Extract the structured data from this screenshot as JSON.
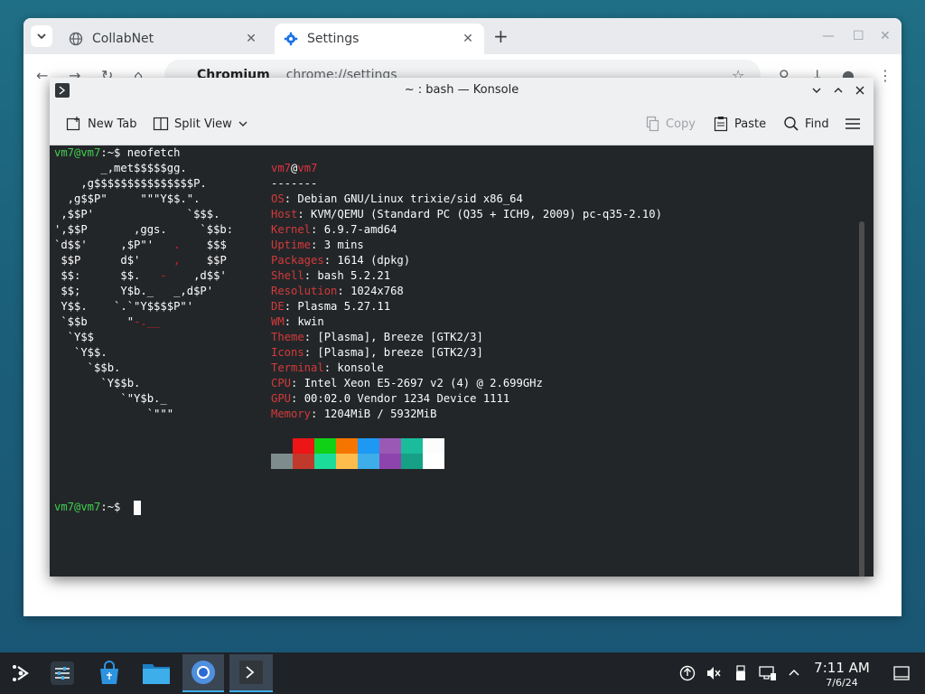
{
  "colors": {
    "terminal_bg": "#232629",
    "prompt_green": "#3fd04f",
    "key_red": "#d33a3a",
    "accent_blue": "#3daee9"
  },
  "browser": {
    "tabs": [
      {
        "title": "CollabNet",
        "icon": "globe-icon"
      },
      {
        "title": "Settings",
        "icon": "gear-icon"
      }
    ],
    "omnibox_chip": "Chromium",
    "url": "chrome://settings"
  },
  "konsole": {
    "title": "~ : bash — Konsole",
    "toolbar": {
      "new_tab": "New Tab",
      "split_view": "Split View",
      "copy": "Copy",
      "paste": "Paste",
      "find": "Find"
    },
    "terminal": {
      "prompt_user": "vm7@vm7",
      "prompt_suffix": ":~$",
      "command": "neofetch",
      "header_user": "vm7",
      "header_at": "@",
      "header_host": "vm7",
      "separator": "-------",
      "info": [
        {
          "key": "OS",
          "value": "Debian GNU/Linux trixie/sid x86_64"
        },
        {
          "key": "Host",
          "value": "KVM/QEMU (Standard PC (Q35 + ICH9, 2009) pc-q35-2.10)"
        },
        {
          "key": "Kernel",
          "value": "6.9.7-amd64"
        },
        {
          "key": "Uptime",
          "value": "3 mins"
        },
        {
          "key": "Packages",
          "value": "1614 (dpkg)"
        },
        {
          "key": "Shell",
          "value": "bash 5.2.21"
        },
        {
          "key": "Resolution",
          "value": "1024x768"
        },
        {
          "key": "DE",
          "value": "Plasma 5.27.11"
        },
        {
          "key": "WM",
          "value": "kwin"
        },
        {
          "key": "Theme",
          "value": "[Plasma], Breeze [GTK2/3]"
        },
        {
          "key": "Icons",
          "value": "[Plasma], breeze [GTK2/3]"
        },
        {
          "key": "Terminal",
          "value": "konsole"
        },
        {
          "key": "CPU",
          "value": "Intel Xeon E5-2697 v2 (4) @ 2.699GHz"
        },
        {
          "key": "GPU",
          "value": "00:02.0 Vendor 1234 Device 1111"
        },
        {
          "key": "Memory",
          "value": "1204MiB / 5932MiB"
        }
      ],
      "logo_lines": [
        "       _,met$$$$$gg.",
        "    ,g$$$$$$$$$$$$$$$P.",
        "  ,g$$P\"     \"\"\"Y$$.\".",
        " ,$$P'              `$$$.",
        "',$$P       ,ggs.     `$$b:",
        "`d$$'     ,$P\"'   .    $$$",
        " $$P      d$'     ,    $$P",
        " $$:      $$.   -    ,d$$'",
        " $$;      Y$b._   _,d$P'",
        " Y$$.    `.`\"Y$$$$P\"'",
        " `$$b      \"-.__",
        "  `Y$$",
        "   `Y$$.",
        "     `$$b.",
        "       `Y$$b.",
        "          `\"Y$b._",
        "              `\"\"\""
      ],
      "palette_top": [
        "#232629",
        "#ed1515",
        "#11d116",
        "#f67400",
        "#1d99f3",
        "#9b59b6",
        "#1abc9c",
        "#fcfcfc"
      ],
      "palette_bottom": [
        "#7f8c8d",
        "#c0392b",
        "#1cdc9a",
        "#fdbc4b",
        "#3daee9",
        "#8e44ad",
        "#16a085",
        "#ffffff"
      ]
    }
  },
  "taskbar": {
    "time": "7:11 AM",
    "date": "7/6/24"
  }
}
